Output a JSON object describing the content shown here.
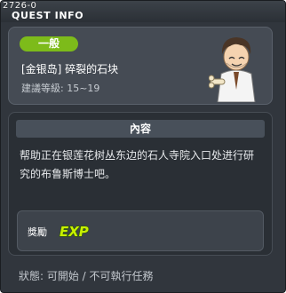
{
  "window": {
    "id": "2726-0",
    "title": "QUEST INFO"
  },
  "quest": {
    "category_badge": "一般",
    "name": "[金银岛] 碎裂的石块",
    "level_requirement": "建議等級: 15~19"
  },
  "content": {
    "header": "內容",
    "description": "帮助正在银莲花树丛东边的石人寺院入口处进行研究的布鲁斯博士吧。"
  },
  "reward": {
    "label": "獎勵",
    "icon": "exp-icon",
    "icon_text": "EXP"
  },
  "status": {
    "text": "狀態: 可開始 / 不可執行任務"
  },
  "colors": {
    "badge": "#7dbb1a",
    "exp": "#c8f000"
  },
  "npc": {
    "icon": "npc-portrait"
  }
}
